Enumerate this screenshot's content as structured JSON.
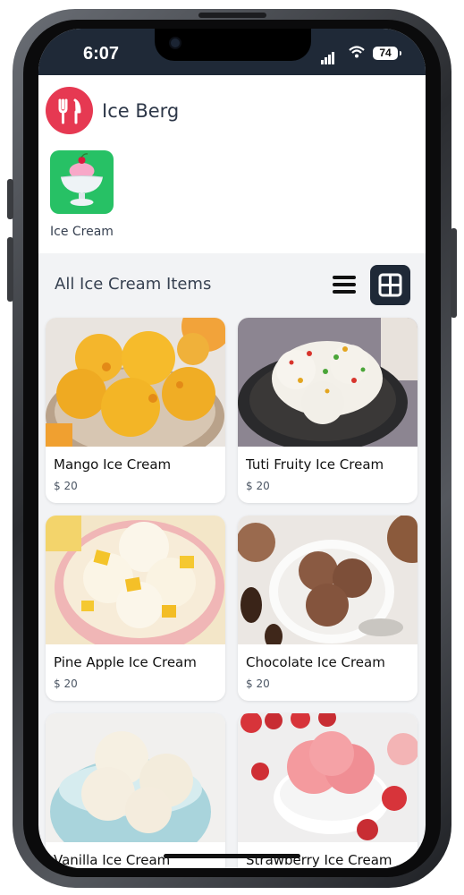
{
  "status": {
    "time": "6:07",
    "battery": "74"
  },
  "header": {
    "brand": "Ice Berg",
    "logo_icon": "fork-knife-icon",
    "accent": "#e63952"
  },
  "categories": [
    {
      "label": "Ice Cream",
      "icon": "ice-cream-sundae-icon",
      "color": "#27c165"
    }
  ],
  "section": {
    "title": "All Ice Cream Items",
    "active_view": "grid"
  },
  "items": [
    {
      "name": "Mango Ice Cream",
      "price": "$ 20"
    },
    {
      "name": "Tuti Fruity Ice Cream",
      "price": "$ 20"
    },
    {
      "name": "Pine Apple Ice Cream",
      "price": "$ 20"
    },
    {
      "name": "Chocolate Ice Cream",
      "price": "$ 20"
    },
    {
      "name": "Vanilla Ice Cream",
      "price": ""
    },
    {
      "name": "Strawberry Ice Cream",
      "price": ""
    }
  ]
}
